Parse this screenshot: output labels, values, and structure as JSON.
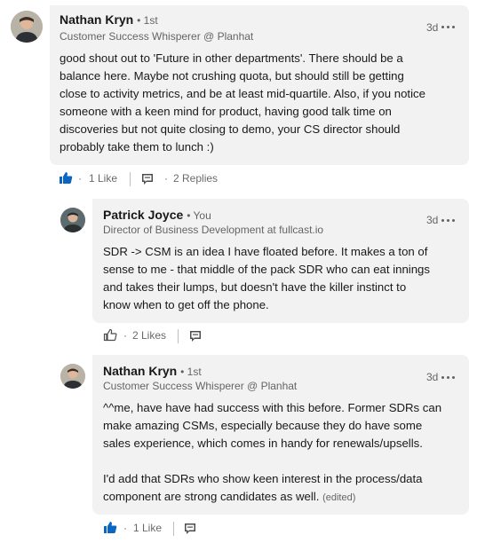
{
  "colors": {
    "like_blue": "#0a66c2",
    "bubble_bg": "#f2f2f2",
    "muted": "rgba(0,0,0,0.6)"
  },
  "comments": [
    {
      "author": "Nathan Kryn",
      "degree": "• 1st",
      "headline": "Customer Success Whisperer @ Planhat",
      "time": "3d",
      "text": "good shout out to 'Future in other departments'. There should be a\nbalance here. Maybe not crushing quota, but should still be getting\nclose to activity metrics, and be at least mid-quartile. Also, if you notice\nsomeone with a keen mind for product, having good talk time on\ndiscoveries but not quite closing to demo, your CS director should\nprobably take them to lunch :)",
      "edited": "",
      "likes": "1 Like",
      "replies": "2 Replies",
      "liked": true,
      "like_icon": "thumbs-up-filled-icon",
      "reply_icon": "reply-icon"
    },
    {
      "author": "Patrick Joyce",
      "degree": "• You",
      "headline": "Director of Business Development at fullcast.io",
      "time": "3d",
      "text": "SDR -> CSM is an idea I have floated before. It makes a ton of\nsense to me - that middle of the pack SDR who can eat innings\nand takes their lumps, but doesn't have the killer instinct to\nknow when to get off the phone.",
      "edited": "",
      "likes": "2 Likes",
      "replies": "",
      "liked": false,
      "like_icon": "thumbs-up-outline-icon",
      "reply_icon": "reply-icon"
    },
    {
      "author": "Nathan Kryn",
      "degree": "• 1st",
      "headline": "Customer Success Whisperer @ Planhat",
      "time": "3d",
      "text": "^^me, have have had success with this before. Former SDRs  can\nmake amazing CSMs, especially because they do have some\nsales experience, which comes in handy for renewals/upsells.\n\nI'd add that SDRs who show keen interest in the process/data\ncomponent are strong candidates as well.",
      "edited": "(edited)",
      "likes": "1 Like",
      "replies": "",
      "liked": true,
      "like_icon": "thumbs-up-filled-icon",
      "reply_icon": "reply-icon"
    }
  ]
}
